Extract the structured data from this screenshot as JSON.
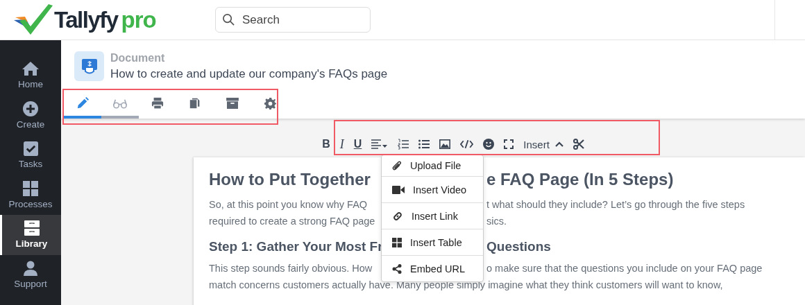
{
  "logo": {
    "name": "Tallyfy",
    "suffix": "pro"
  },
  "search": {
    "placeholder": "Search"
  },
  "sidebar": {
    "items": [
      {
        "kind": "home",
        "label": "Home",
        "selected": false
      },
      {
        "kind": "create",
        "label": "Create",
        "selected": false
      },
      {
        "kind": "tasks",
        "label": "Tasks",
        "selected": false
      },
      {
        "kind": "processes",
        "label": "Processes",
        "selected": false
      },
      {
        "kind": "library",
        "label": "Library",
        "selected": true
      },
      {
        "kind": "support",
        "label": "Support",
        "selected": false
      }
    ]
  },
  "document": {
    "type": "Document",
    "title": "How to create and update our company's FAQs page"
  },
  "tabs": [
    {
      "kind": "edit",
      "selected": true,
      "hovered": false
    },
    {
      "kind": "view",
      "selected": false,
      "hovered": true
    },
    {
      "kind": "print",
      "selected": false,
      "hovered": false
    },
    {
      "kind": "copy",
      "selected": false,
      "hovered": false
    },
    {
      "kind": "archive",
      "selected": false,
      "hovered": false
    },
    {
      "kind": "settings",
      "selected": false,
      "hovered": false
    }
  ],
  "editor_toolbar": [
    {
      "kind": "bold",
      "label": "B"
    },
    {
      "kind": "italic",
      "label": "I"
    },
    {
      "kind": "underline",
      "label": "U"
    },
    {
      "kind": "align"
    },
    {
      "kind": "ordered-list"
    },
    {
      "kind": "bullet-list"
    },
    {
      "kind": "image"
    },
    {
      "kind": "code"
    },
    {
      "kind": "emoji"
    },
    {
      "kind": "fullscreen"
    },
    {
      "kind": "insert",
      "label": "Insert",
      "expanded": true
    },
    {
      "kind": "cut"
    }
  ],
  "insert_menu": [
    {
      "kind": "file",
      "label": "Upload File"
    },
    {
      "kind": "video",
      "label": "Insert Video"
    },
    {
      "kind": "link",
      "label": "Insert Link"
    },
    {
      "kind": "table",
      "label": "Insert Table"
    },
    {
      "kind": "share",
      "label": "Embed URL"
    }
  ],
  "content": [
    {
      "kind": "h1",
      "lines": [
        [
          "How to Put Together",
          "e FAQ Page (In 5 Steps)"
        ]
      ]
    },
    {
      "kind": "p",
      "lines": [
        [
          "So, at this point you know why FAQ",
          "t what should they include? Let’s go through the five steps"
        ],
        [
          "required to create a strong FAQ page",
          "sics."
        ]
      ]
    },
    {
      "kind": "h2",
      "lines": [
        [
          "Step 1: Gather Your Most Fr",
          "Questions"
        ]
      ]
    },
    {
      "kind": "p",
      "lines": [
        [
          "This step sounds fairly obvious. How",
          "o make sure that the questions you include on your FAQ page"
        ],
        [
          "match concerns customers actually have. Many people simply imagine what they think customers will want to know,"
        ]
      ]
    }
  ]
}
